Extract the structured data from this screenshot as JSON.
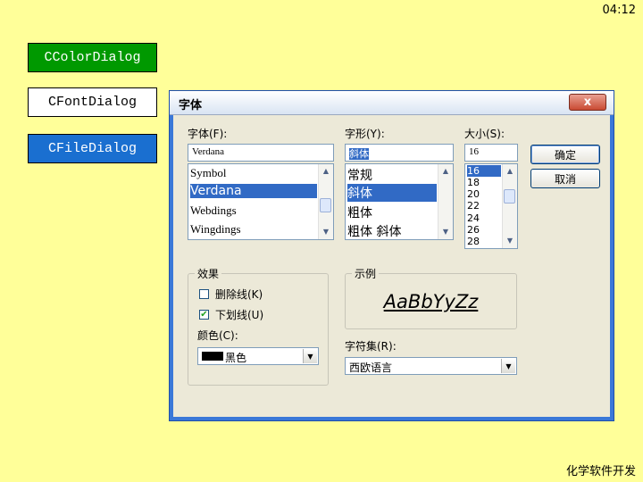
{
  "clock": "04:12",
  "footer": "化学软件开发",
  "slide_buttons": [
    "CColorDialog",
    "CFontDialog",
    "CFileDialog"
  ],
  "colors": {
    "background": "#ffff99",
    "color_btn": "#009900",
    "file_btn": "#1a6fd0",
    "dialog_frame": "#3a78d8",
    "selection": "#316ac5"
  },
  "dialog": {
    "title": "字体",
    "close": "x",
    "font": {
      "label": "字体(F):",
      "value": "Verdana",
      "items": [
        "Symbol",
        "Verdana",
        "Webdings",
        "Wingdings"
      ],
      "selected": "Verdana"
    },
    "style": {
      "label": "字形(Y):",
      "value": "斜体",
      "items": [
        "常规",
        "斜体",
        "粗体",
        "粗体 斜体"
      ],
      "selected": "斜体"
    },
    "size": {
      "label": "大小(S):",
      "value": "16",
      "items": [
        "16",
        "18",
        "20",
        "22",
        "24",
        "26",
        "28"
      ],
      "selected": "16"
    },
    "ok": "确定",
    "cancel": "取消",
    "effects": {
      "title": "效果",
      "strikeout": "删除线(K)",
      "strikeout_checked": false,
      "underline": "下划线(U)",
      "underline_checked": true,
      "color_label": "颜色(C):",
      "color_value": "黑色"
    },
    "sample": {
      "title": "示例",
      "text": "AaBbYyZz"
    },
    "script": {
      "label": "字符集(R):",
      "value": "西欧语言"
    }
  }
}
